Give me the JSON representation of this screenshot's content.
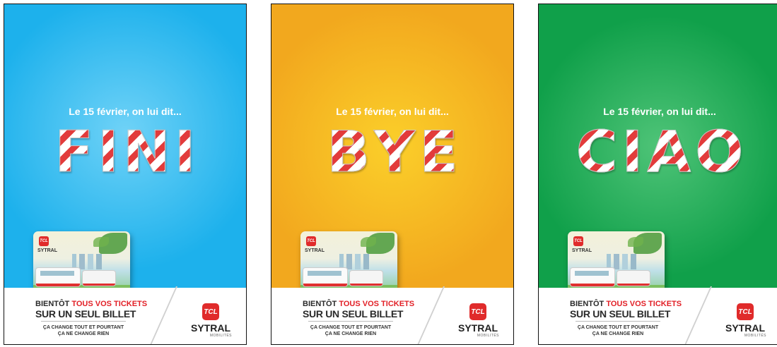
{
  "posters": [
    {
      "bg_color": "#1db1ec",
      "tagline": "Le 15 février, on lui dit...",
      "word_letters": [
        "F",
        "I",
        "N",
        "I"
      ],
      "card_brand": "SYTRAL",
      "card_logo": "TCL",
      "headline_prefix": "BIENTÔT ",
      "headline_highlight": "TOUS VOS TICKETS",
      "headline_line2": "SUR UN SEUL BILLET",
      "subline1": "ÇA CHANGE TOUT ET POURTANT",
      "subline2": "ÇA NE CHANGE RIEN",
      "logo_text": "TCL",
      "brand": "SYTRAL",
      "brand_sub": "MOBILITÉS"
    },
    {
      "bg_color": "#f5b21c",
      "tagline": "Le 15 février, on lui dit...",
      "word_letters": [
        "B",
        "Y",
        "E"
      ],
      "card_brand": "SYTRAL",
      "card_logo": "TCL",
      "headline_prefix": "BIENTÔT ",
      "headline_highlight": "TOUS VOS TICKETS",
      "headline_line2": "SUR UN SEUL BILLET",
      "subline1": "ÇA CHANGE TOUT ET POURTANT",
      "subline2": "ÇA NE CHANGE RIEN",
      "logo_text": "TCL",
      "brand": "SYTRAL",
      "brand_sub": "MOBILITÉS"
    },
    {
      "bg_color": "#12a14a",
      "tagline": "Le 15 février, on lui dit...",
      "word_letters": [
        "C",
        "I",
        "A",
        "O"
      ],
      "card_brand": "SYTRAL",
      "card_logo": "TCL",
      "headline_prefix": "BIENTÔT ",
      "headline_highlight": "TOUS VOS TICKETS",
      "headline_line2": "SUR UN SEUL BILLET",
      "subline1": "ÇA CHANGE TOUT ET POURTANT",
      "subline2": "ÇA NE CHANGE RIEN",
      "logo_text": "TCL",
      "brand": "SYTRAL",
      "brand_sub": "MOBILITÉS"
    }
  ],
  "colors": {
    "accent_red": "#e21f26",
    "text_dark": "#2a2a2a"
  }
}
